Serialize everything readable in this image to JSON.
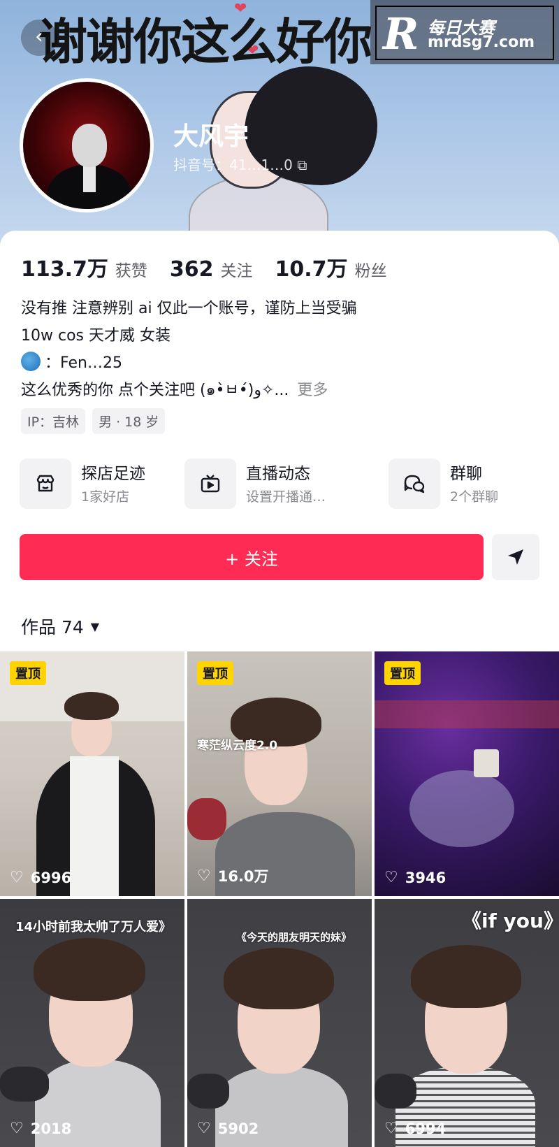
{
  "banner": {
    "title": "谢谢你这么好你",
    "watermark_top": "每日大赛",
    "watermark_bottom": "mrdsg7.com",
    "watermark_logo": "R"
  },
  "profile": {
    "username": "大风宇",
    "account_id": "抖音号：41…1…0 ⧉"
  },
  "stats": [
    {
      "value": "113.7万",
      "label": "获赞"
    },
    {
      "value": "362",
      "label": "关注"
    },
    {
      "value": "10.7万",
      "label": "粉丝"
    }
  ],
  "bio": {
    "line1": "没有推 注意辨别 ai 仅此一个账号，谨防上当受骗",
    "line2": "10w cos 天才威 女装",
    "line3_prefix": "：",
    "line3": "Fen…25",
    "line4": "这么优秀的你 点个关注吧 (๑•̀ㅂ•́)و✧...",
    "more": "更多"
  },
  "tags": [
    "IP：吉林",
    "男 · 18 岁"
  ],
  "shortcuts": [
    {
      "icon": "shop-icon",
      "title": "探店足迹",
      "sub": "1家好店"
    },
    {
      "icon": "live-tv-icon",
      "title": "直播动态",
      "sub": "设置开播通…"
    },
    {
      "icon": "group-chat-icon",
      "title": "群聊",
      "sub": "2个群聊"
    }
  ],
  "actions": {
    "follow": "+ 关注"
  },
  "works": {
    "label": "作品 74"
  },
  "videos": [
    {
      "pinned": "置顶",
      "likes": "6996",
      "caption": ""
    },
    {
      "pinned": "置顶",
      "likes": "16.0万",
      "caption": "寒茫纵云度2.0"
    },
    {
      "pinned": "置顶",
      "likes": "3946",
      "caption": ""
    },
    {
      "pinned": "",
      "likes": "2018",
      "caption": "14小时前我太帅了万人爱》"
    },
    {
      "pinned": "",
      "likes": "5902",
      "caption": "《今天的朋友明天的妹》"
    },
    {
      "pinned": "",
      "likes": "6994",
      "caption": "《if you》"
    }
  ],
  "colors": {
    "accent": "#fe2c55",
    "pin": "#ffd400",
    "banner_top": "#8fb3dc"
  }
}
